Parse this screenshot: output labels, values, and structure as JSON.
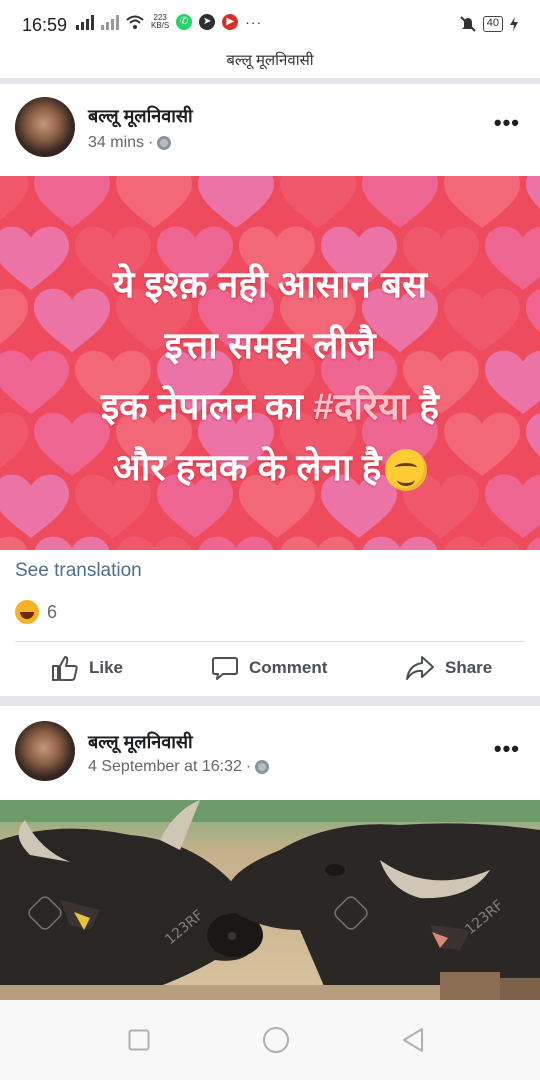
{
  "status_bar": {
    "time": "16:59",
    "net_speed_value": "223",
    "net_speed_unit": "KB/S",
    "battery": "40",
    "more": "···"
  },
  "page": {
    "title": "बल्लू मूलनिवासी"
  },
  "posts": [
    {
      "author": "बल्लू मूलनिवासी",
      "time": "34 mins",
      "sep": "·",
      "more": "•••",
      "image_text": {
        "line1": "ये इश्क़ नही आसान बस",
        "line2": "इत्ता समझ लीजै",
        "line3_before": "इक नेपालन का ",
        "hashtag": "#दरिया",
        "line3_after": " है",
        "line4": "और हचक के लेना है"
      },
      "see_translation": "See translation",
      "reaction_count": "6",
      "actions": {
        "like": "Like",
        "comment": "Comment",
        "share": "Share"
      }
    },
    {
      "author": "बल्लू मूलनिवासी",
      "time": "4 September at 16:32",
      "sep": "·",
      "more": "•••",
      "watermark": "123RF"
    }
  ],
  "colors": {
    "image_bg": "#ef4b5f",
    "link": "#4d6e8e",
    "divider": "#e4e6eb",
    "meta": "#65676b"
  },
  "icons": [
    "signal-icon",
    "wifi-icon",
    "whatsapp-icon",
    "telegram-icon",
    "youtube-icon",
    "mute-icon",
    "battery-icon",
    "charging-icon",
    "globe-icon",
    "haha-icon",
    "like-icon",
    "comment-icon",
    "share-icon",
    "square-nav-icon",
    "home-nav-icon",
    "back-nav-icon"
  ]
}
